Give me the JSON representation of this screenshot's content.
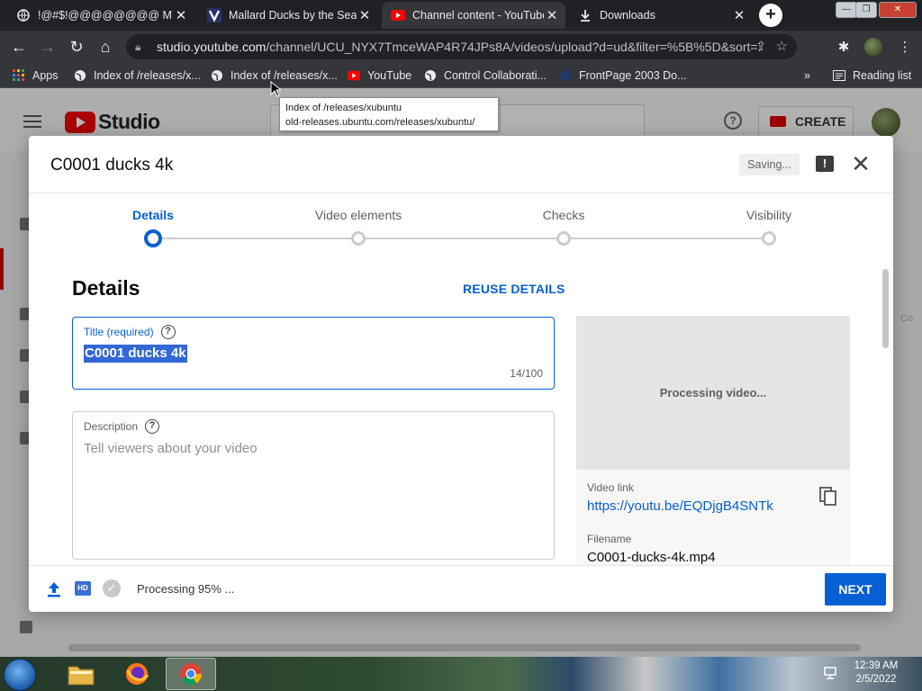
{
  "browser": {
    "tabs": [
      {
        "title": "!@#$!@@@@@@@@ MY",
        "icon": "globe-icon"
      },
      {
        "title": "Mallard Ducks by the Sea",
        "icon": "v-icon"
      },
      {
        "title": "Channel content - YouTube",
        "icon": "youtube-icon"
      },
      {
        "title": "Downloads",
        "icon": "download-icon"
      }
    ],
    "new_tab": "+",
    "address": {
      "host": "studio.youtube.com",
      "path": "/channel/UCU_NYX7TmceWAP4R74JPs8A/videos/upload?d=ud&filter=%5B%5D&sort=..."
    },
    "bookmarks": [
      {
        "label": "Apps",
        "icon": "apps-grid-icon"
      },
      {
        "label": "Index of /releases/x...",
        "icon": "globe-icon"
      },
      {
        "label": "Index of /releases/x...",
        "icon": "globe-icon"
      },
      {
        "label": "YouTube",
        "icon": "youtube-icon"
      },
      {
        "label": "Control Collaborati...",
        "icon": "globe-icon"
      },
      {
        "label": "FrontPage 2003 Do...",
        "icon": "frontpage-icon"
      }
    ],
    "bookmarks_overflow": "»",
    "reading_list": "Reading list",
    "tooltip": {
      "line1": "Index of /releases/xubuntu",
      "line2": "old-releases.ubuntu.com/releases/xubuntu/"
    }
  },
  "studio": {
    "logo_text": "Studio",
    "create_label": "CREATE",
    "help_glyph": "?",
    "side_cut_text": "Co"
  },
  "dialog": {
    "title": "C0001 ducks 4k",
    "saving": "Saving...",
    "steps": [
      {
        "label": "Details",
        "active": true
      },
      {
        "label": "Video elements",
        "active": false
      },
      {
        "label": "Checks",
        "active": false
      },
      {
        "label": "Visibility",
        "active": false
      }
    ],
    "section_title": "Details",
    "reuse_details": "REUSE DETAILS",
    "title_field": {
      "label": "Title (required)",
      "value": "C0001 ducks 4k",
      "counter": "14/100"
    },
    "description_field": {
      "label": "Description",
      "placeholder": "Tell viewers about your video"
    },
    "preview": {
      "processing": "Processing video...",
      "video_link_label": "Video link",
      "video_link": "https://youtu.be/EQDjgB4SNTk",
      "filename_label": "Filename",
      "filename": "C0001-ducks-4k.mp4"
    },
    "footer": {
      "hd_badge": "HD",
      "status": "Processing 95% ...",
      "next": "NEXT"
    }
  },
  "taskbar": {
    "time": "12:39 AM",
    "date": "2/5/2022"
  },
  "colors": {
    "accent": "#065fd4",
    "youtube_red": "#ff0000",
    "chrome_dark": "#202124"
  }
}
